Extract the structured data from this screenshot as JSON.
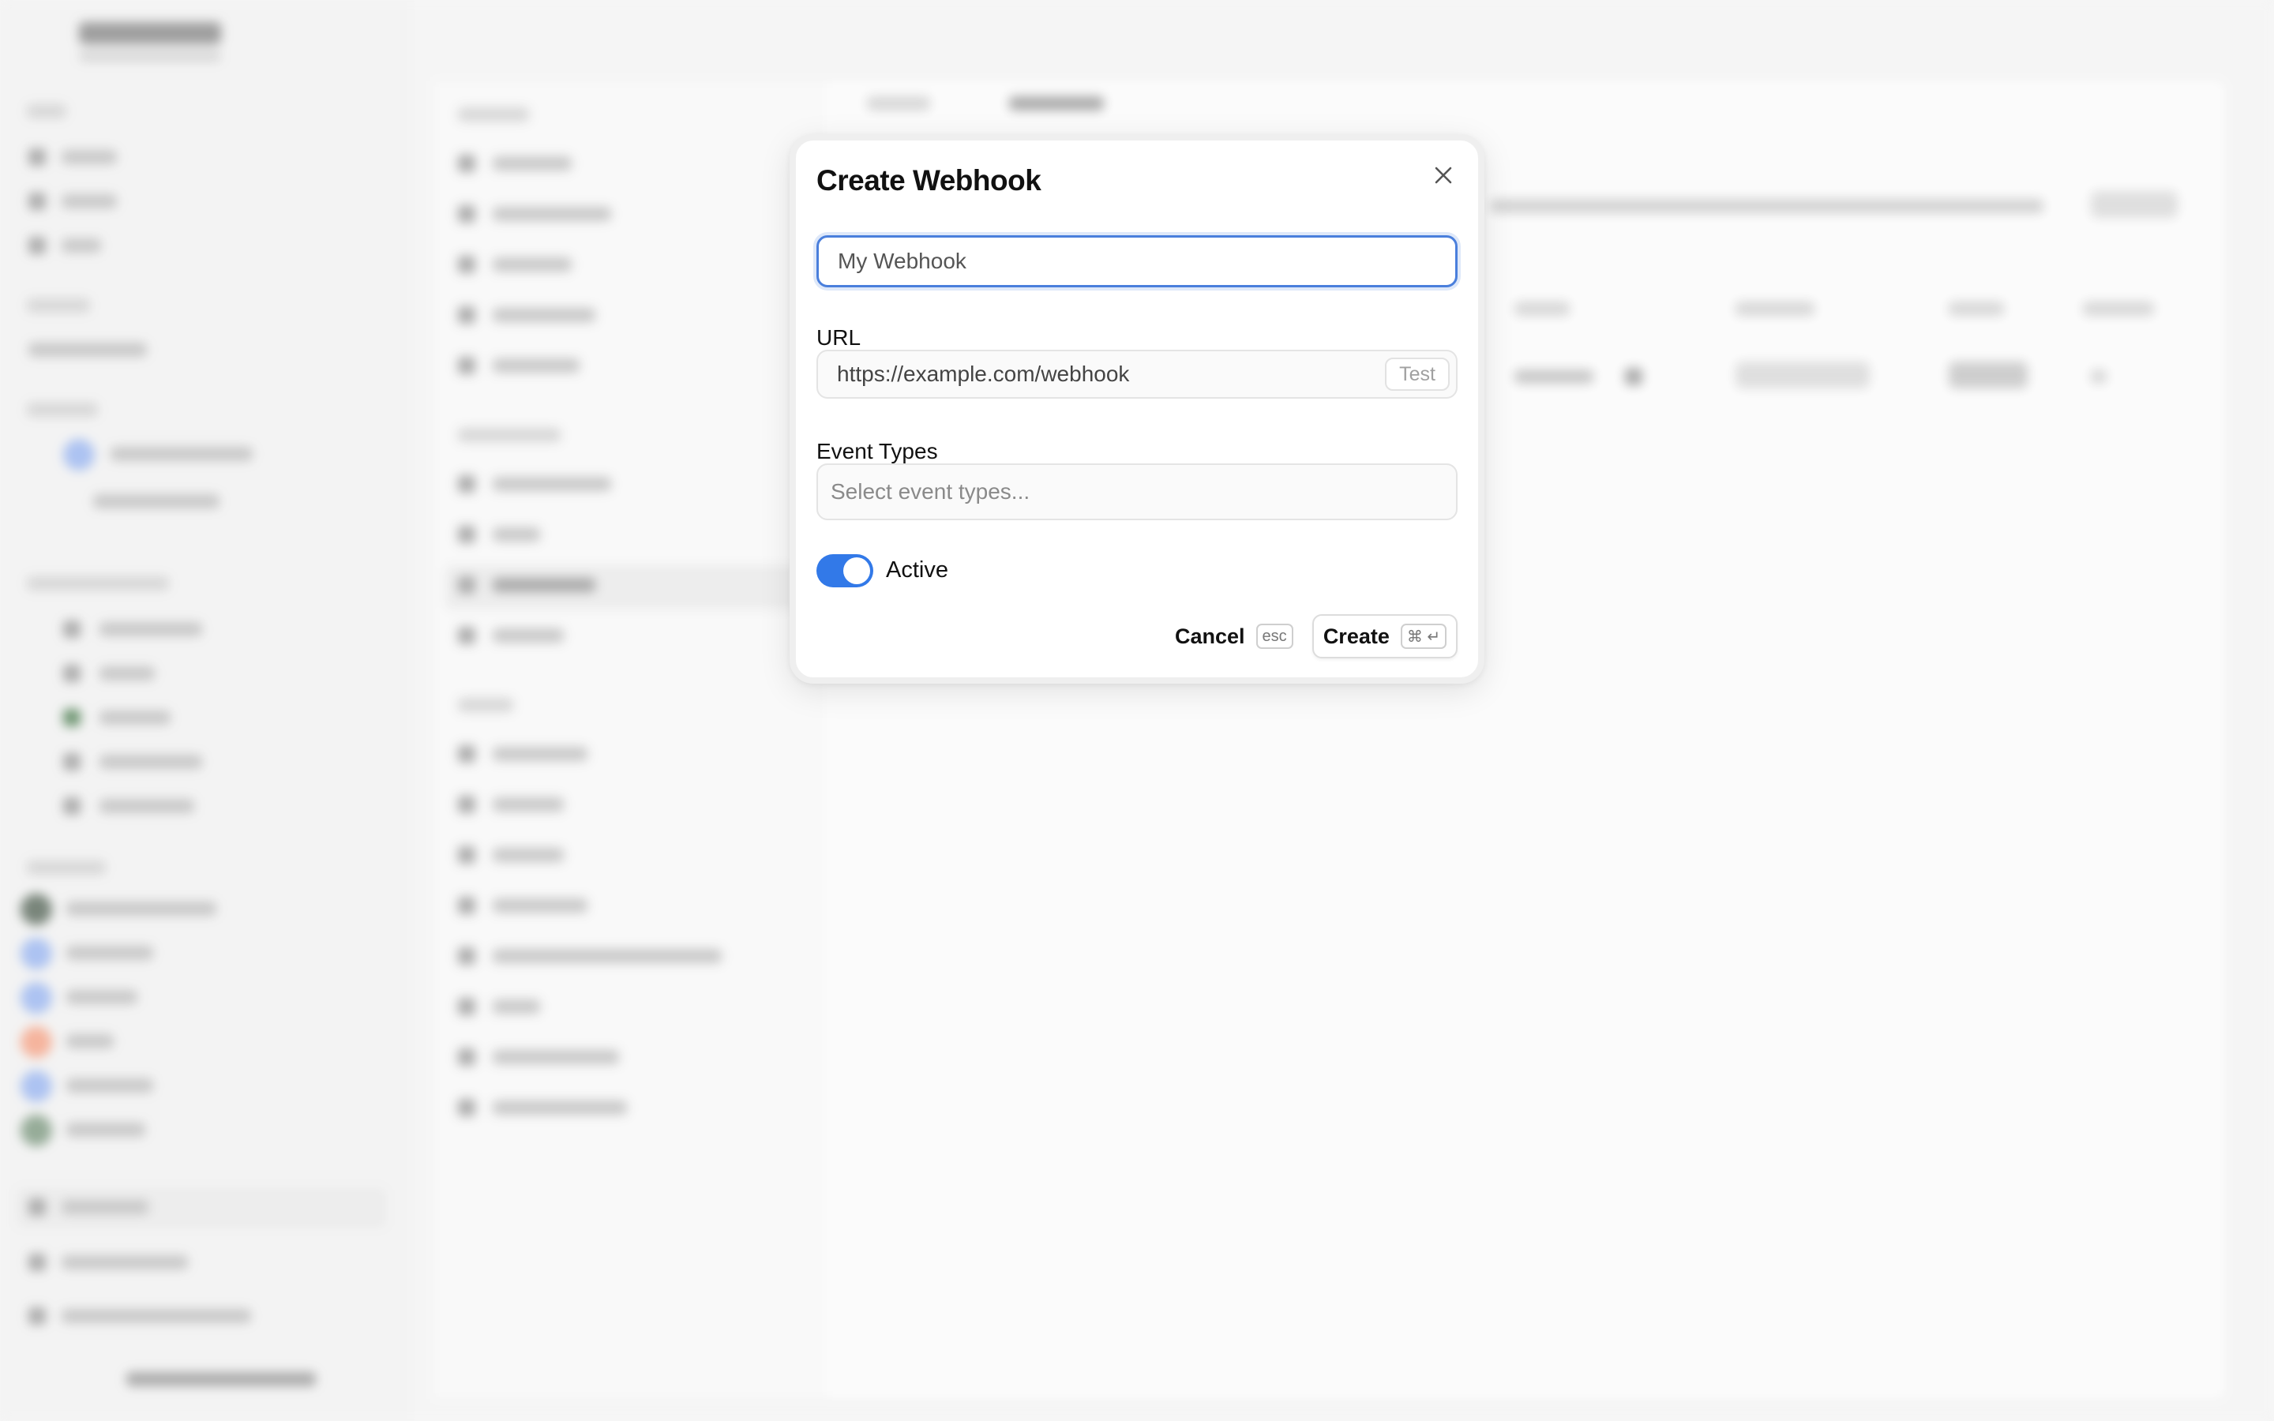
{
  "dialog": {
    "title": "Create Webhook",
    "name_field": {
      "value": "My Webhook",
      "placeholder": "My Webhook"
    },
    "url_label": "URL",
    "url_field": {
      "placeholder": "https://example.com/webhook"
    },
    "test_label": "Test",
    "event_types_label": "Event Types",
    "event_types_placeholder": "Select event types...",
    "active_label": "Active",
    "active_on": true,
    "cancel_label": "Cancel",
    "cancel_shortcut": "esc",
    "create_label": "Create",
    "create_shortcut": "⌘ ↵"
  },
  "colors": {
    "accent": "#3279e8",
    "focus_border": "#4a7fdc",
    "overlay": "#f4f4f4"
  },
  "icons": {
    "close": "close-icon"
  }
}
